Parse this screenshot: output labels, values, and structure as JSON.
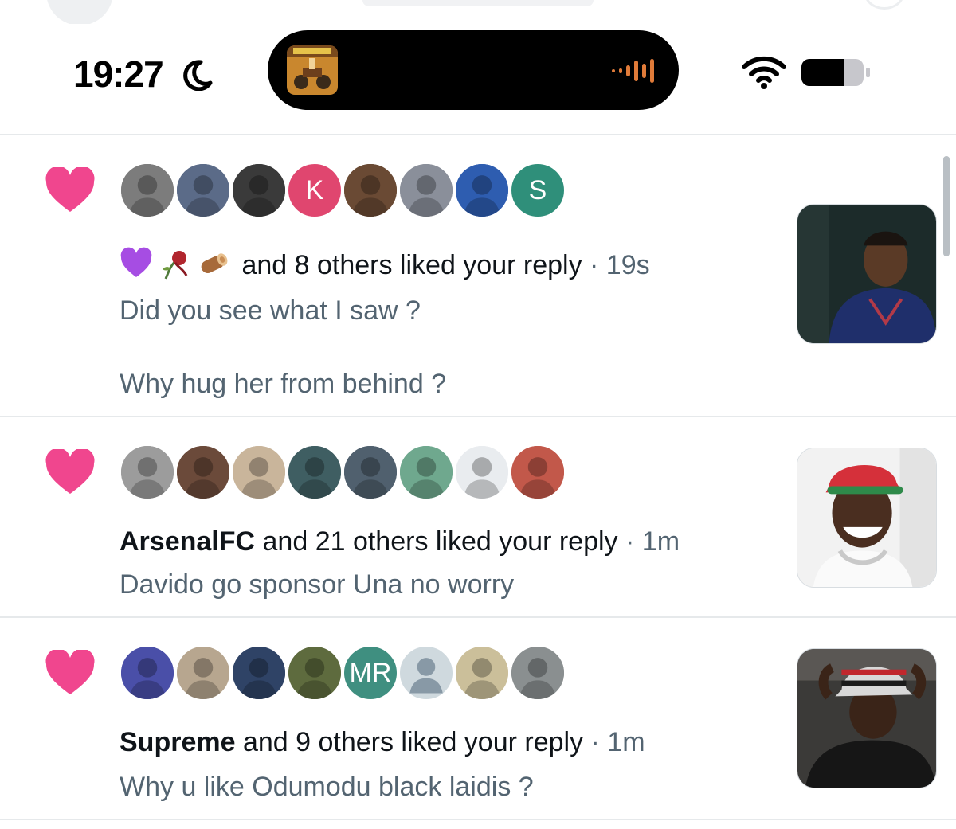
{
  "status_bar": {
    "time": "19:27"
  },
  "notifications": [
    {
      "icon": "heart-icon",
      "avatars": [
        {
          "type": "photo",
          "color": "#7c7c7c"
        },
        {
          "type": "photo",
          "color": "#5b6b88"
        },
        {
          "type": "photo",
          "color": "#3a3a3a"
        },
        {
          "type": "letter",
          "letter": "K",
          "color": "#e0466f"
        },
        {
          "type": "photo",
          "color": "#6a4a34"
        },
        {
          "type": "photo",
          "color": "#8a8f9a"
        },
        {
          "type": "photo",
          "color": "#2e5db0"
        },
        {
          "type": "letter",
          "letter": "S",
          "color": "#2f8f7a"
        }
      ],
      "emoji_names": [
        "purple-heart-icon",
        "wilted-rose-icon",
        "wood-log-icon"
      ],
      "actor": "",
      "summary_text": "and 8 others liked your reply",
      "time": "· 19s",
      "reply_lines": [
        "Did you see what I saw ?",
        "Why hug her from behind ?"
      ]
    },
    {
      "icon": "heart-icon",
      "avatars": [
        {
          "type": "photo",
          "color": "#9c9c9c"
        },
        {
          "type": "photo",
          "color": "#6b4a3a"
        },
        {
          "type": "photo",
          "color": "#c9b59b"
        },
        {
          "type": "photo",
          "color": "#3f5e62"
        },
        {
          "type": "photo",
          "color": "#50606e"
        },
        {
          "type": "photo",
          "color": "#6fa88e"
        },
        {
          "type": "photo",
          "color": "#e9ecef"
        },
        {
          "type": "photo",
          "color": "#c2584a"
        }
      ],
      "emoji_names": [],
      "actor": "ArsenalFC",
      "summary_text": "and 21 others liked your reply",
      "time": "· 1m",
      "reply_lines": [
        "Davido go sponsor Una no worry"
      ]
    },
    {
      "icon": "heart-icon",
      "avatars": [
        {
          "type": "photo",
          "color": "#4a4fa8"
        },
        {
          "type": "photo",
          "color": "#b7a68f"
        },
        {
          "type": "photo",
          "color": "#2f4366"
        },
        {
          "type": "photo",
          "color": "#5e6b3e"
        },
        {
          "type": "letter",
          "letter": "MR",
          "color": "#3f8f80"
        },
        {
          "type": "default",
          "color": "#cfd9de"
        },
        {
          "type": "photo",
          "color": "#cbbf9a"
        },
        {
          "type": "photo",
          "color": "#8a8f90"
        }
      ],
      "emoji_names": [],
      "actor": "Supreme",
      "summary_text": "and 9 others liked your reply",
      "time": "· 1m",
      "reply_lines": [
        "Why u like Odumodu black laidis ?"
      ]
    }
  ],
  "colors": {
    "heart": "#f0468e",
    "secondary_text": "#536471",
    "primary_text": "#0f1419",
    "divider": "#e6e9eb"
  }
}
